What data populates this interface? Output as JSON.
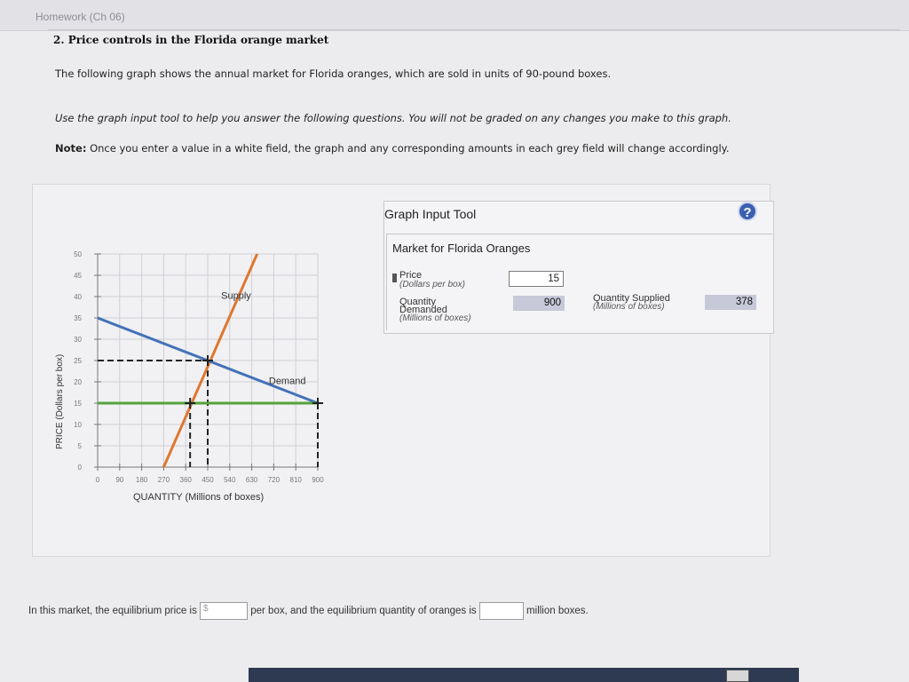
{
  "header": {
    "title": "Homework (Ch 06)"
  },
  "question": {
    "title": "2. Price controls in the Florida orange market",
    "intro": "The following graph shows the annual market for Florida oranges, which are sold in units of 90-pound boxes.",
    "instruction": "Use the graph input tool to help you answer the following questions. You will not be graded on any changes you make to this graph.",
    "note_label": "Note:",
    "note_text": " Once you enter a value in a white field, the graph and any corresponding amounts in each grey field will change accordingly."
  },
  "graph": {
    "supply_label": "Supply",
    "demand_label": "Demand",
    "xlabel": "QUANTITY (Millions of boxes)",
    "ylabel": "PRICE (Dollars per box)"
  },
  "tool": {
    "title": "Graph Input Tool",
    "help": "?",
    "market_title": "Market for Florida Oranges",
    "price_label": "Price",
    "price_sub": "(Dollars per box)",
    "price_value": "15",
    "qd_label_1": "Quantity",
    "qd_label_2": "Demanded",
    "qd_sub": "(Millions of boxes)",
    "qd_value": "900",
    "qs_label": "Quantity Supplied",
    "qs_sub": "(Millions of boxes)",
    "qs_value": "378"
  },
  "bottom": {
    "text1": "In this market, the equilibrium price is ",
    "price_prefix": "$",
    "text2": " per box, and the equilibrium quantity of oranges is ",
    "text3": " million boxes."
  },
  "colors": {
    "supply": "#e0762f",
    "demand": "#4472b8",
    "price_line": "#55a33c",
    "dashed": "#222222"
  },
  "chart_data": {
    "type": "line",
    "xlabel": "QUANTITY (Millions of boxes)",
    "ylabel": "PRICE (Dollars per box)",
    "xlim": [
      0,
      900
    ],
    "ylim": [
      0,
      50
    ],
    "xticks": [
      0,
      90,
      180,
      270,
      360,
      450,
      540,
      630,
      720,
      810,
      900
    ],
    "yticks": [
      0,
      5,
      10,
      15,
      20,
      25,
      30,
      35,
      40,
      45,
      50
    ],
    "series": [
      {
        "name": "Supply",
        "x": [
          270,
          652
        ],
        "y": [
          0,
          50
        ]
      },
      {
        "name": "Demand",
        "x": [
          0,
          900
        ],
        "y": [
          35,
          15
        ]
      },
      {
        "name": "",
        "x": [
          0,
          900
        ],
        "y": [
          15,
          15
        ]
      }
    ],
    "equilibrium": {
      "x": 450,
      "y": 25
    },
    "markers": [
      {
        "x": 450,
        "y": 25
      },
      {
        "x": 378,
        "y": 15
      },
      {
        "x": 900,
        "y": 15
      }
    ]
  }
}
